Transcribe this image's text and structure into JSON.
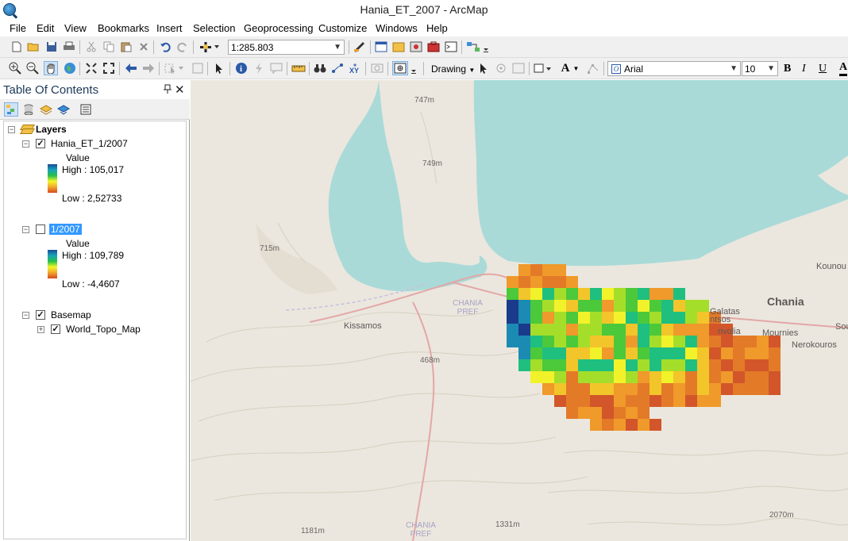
{
  "window": {
    "title": "Hania_ET_2007 - ArcMap",
    "app_icon": "arcmap-globe-icon"
  },
  "menu": [
    "File",
    "Edit",
    "View",
    "Bookmarks",
    "Insert",
    "Selection",
    "Geoprocessing",
    "Customize",
    "Windows",
    "Help"
  ],
  "toolbar1": {
    "scale_value": "1:285.803",
    "buttons": [
      "new-document-icon",
      "open-icon",
      "save-icon",
      "print-icon",
      "cut-icon",
      "copy-icon",
      "paste-icon",
      "delete-icon",
      "undo-icon",
      "redo-icon",
      "add-data-icon"
    ]
  },
  "toolbar2": {
    "drawing_label": "Drawing",
    "font_name": "Arial",
    "font_size": "10",
    "bold": "B",
    "italic": "I",
    "underline": "U"
  },
  "toc": {
    "title": "Table Of Contents",
    "pin_glyph": "📌",
    "close_glyph": "✕",
    "root_label": "Layers",
    "layers": [
      {
        "name": "Hania_ET_1/2007",
        "checked": true,
        "field": "Value",
        "high": "High : 105,017",
        "low": "Low : 2,52733"
      },
      {
        "name": "1/2007",
        "checked": false,
        "selected": true,
        "field": "Value",
        "high": "High : 109,789",
        "low": "Low : -4,4607"
      },
      {
        "name": "Basemap",
        "checked": true,
        "sublayer": "World_Topo_Map",
        "sub_checked": true
      }
    ]
  },
  "map": {
    "water_color": "#a9dad8",
    "land_color": "#ebe7de",
    "labels": {
      "peak_747": "747m",
      "peak_749": "749m",
      "peak_715": "715m",
      "peak_468": "468m",
      "peak_1181": "1181m",
      "peak_1331": "1331m",
      "peak_2070": "2070m",
      "kissamos": "Kissamos",
      "chania_pref": "CHANIA PREF",
      "chania_pref_2": "CHANIA PREF",
      "chania": "Chania",
      "kounou": "Kounou",
      "galatas": "Galatas",
      "ntsos": "ntsos",
      "rivolia": "rivolia",
      "mournies": "Mournies",
      "nerokouros": "Nerokouros",
      "sou": "Sou"
    },
    "raster_palette": [
      "#1a3a8c",
      "#1b8bb3",
      "#1fbf7f",
      "#4cc93a",
      "#a5de2a",
      "#f2f22a",
      "#f2c52a",
      "#ef9a2a",
      "#e37a28",
      "#d2562a"
    ]
  }
}
